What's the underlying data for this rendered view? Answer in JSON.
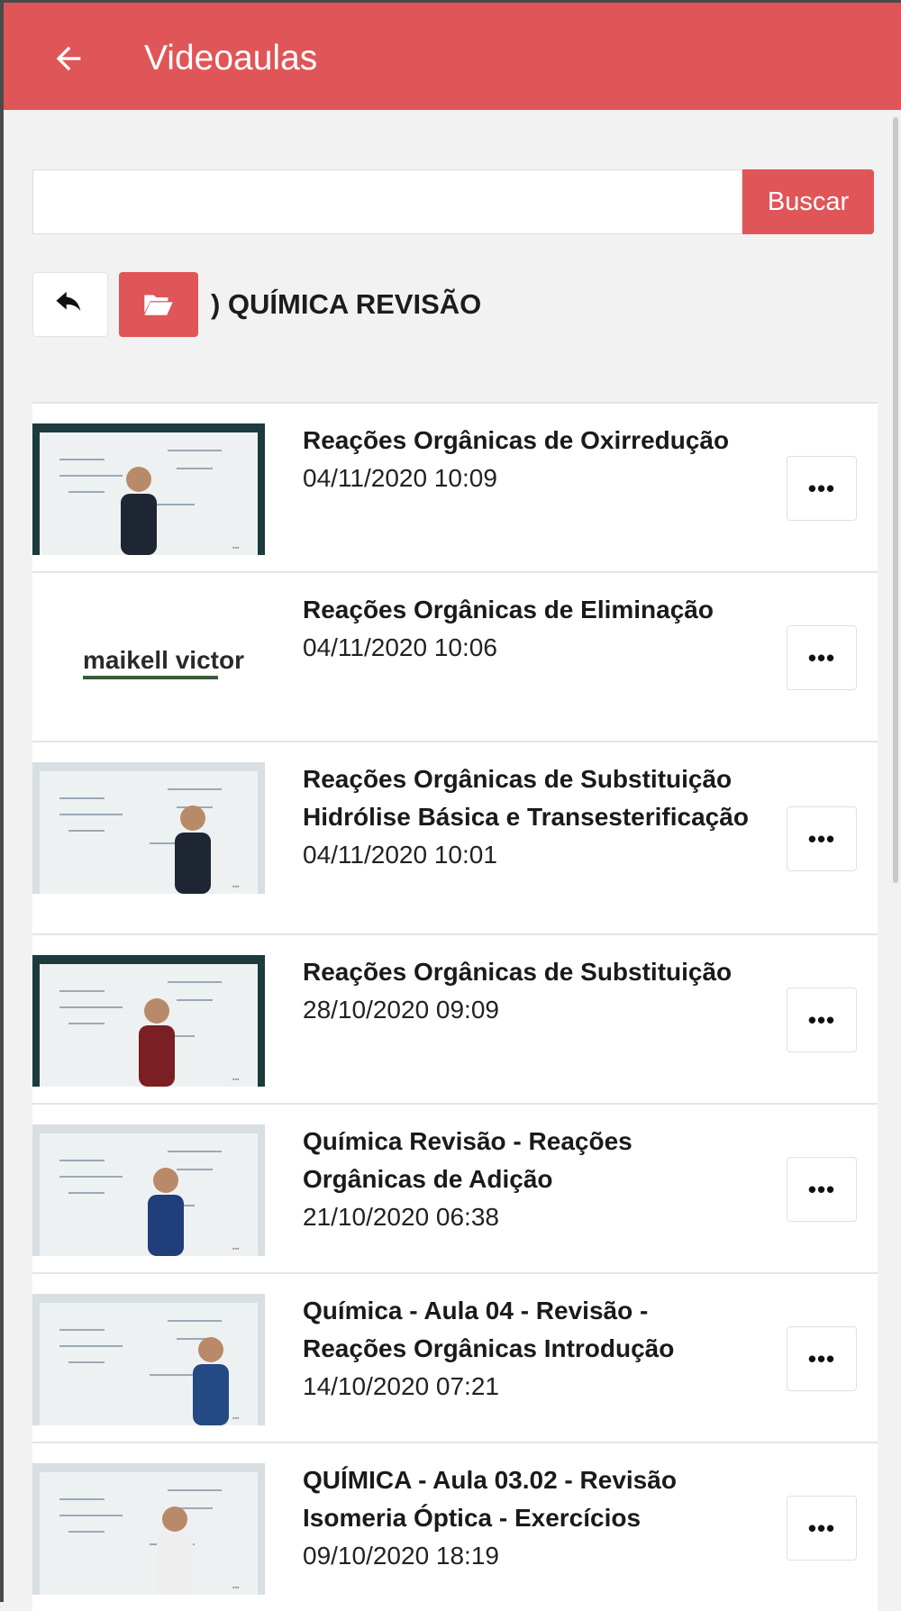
{
  "appbar": {
    "title": "Videoaulas"
  },
  "search": {
    "value": "",
    "placeholder": "",
    "button_label": "Buscar"
  },
  "breadcrumb": {
    "folder_title": ") QUÍMICA REVISÃO"
  },
  "videos": [
    {
      "title": "Reações Orgânicas de Oxirredução",
      "date": "04/11/2020 10:09",
      "thumb_type": "class"
    },
    {
      "title": "Reações Orgânicas de Eliminação",
      "date": "04/11/2020 10:06",
      "thumb_type": "logo",
      "logo_text": "maikell victor"
    },
    {
      "title": "Reações Orgânicas de Substituição Hidrólise Básica e Transesterificação",
      "date": "04/11/2020 10:01",
      "thumb_type": "class"
    },
    {
      "title": "Reações Orgânicas de Substituição",
      "date": "28/10/2020 09:09",
      "thumb_type": "class"
    },
    {
      "title": "Química Revisão - Reações Orgânicas de Adição",
      "date": "21/10/2020 06:38",
      "thumb_type": "class"
    },
    {
      "title": "Química - Aula 04 - Revisão - Reações Orgânicas Introdução",
      "date": "14/10/2020 07:21",
      "thumb_type": "class"
    },
    {
      "title": "QUÍMICA - Aula 03.02 - Revisão Isomeria Óptica - Exercícios",
      "date": "09/10/2020 18:19",
      "thumb_type": "class"
    }
  ],
  "more_button_label": "•••",
  "colors": {
    "accent": "#e05557",
    "background": "#f2f2f2"
  },
  "icons": {
    "back": "arrow-left-icon",
    "undo": "undo-icon",
    "folder": "folder-open-icon",
    "more": "more-horizontal-icon"
  }
}
